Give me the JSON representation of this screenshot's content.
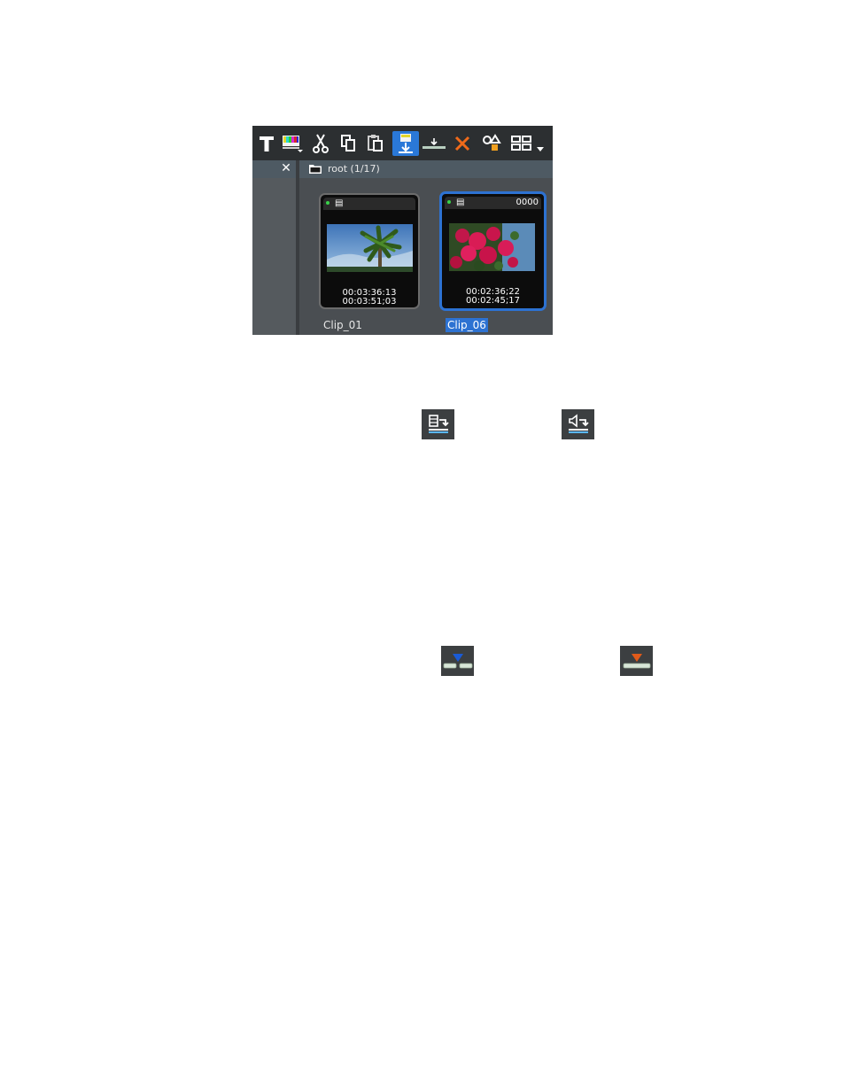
{
  "bin": {
    "folder_label": "root (1/17)",
    "close_glyph": "✕",
    "toolbar": [
      {
        "name": "title-icon",
        "active": false
      },
      {
        "name": "color-bars-icon",
        "active": false
      },
      {
        "name": "cut-icon",
        "active": false
      },
      {
        "name": "copy-icon",
        "active": false
      },
      {
        "name": "paste-icon",
        "active": false
      },
      {
        "name": "add-clip-to-timeline-icon",
        "active": true
      },
      {
        "name": "insert-to-timeline-icon",
        "active": false
      },
      {
        "name": "delete-icon",
        "active": false
      },
      {
        "name": "shapes-icon",
        "active": false
      },
      {
        "name": "view-mode-icon",
        "active": false
      }
    ],
    "clips": [
      {
        "name": "Clip_01",
        "count": "",
        "tc_in": "00:03:36:13",
        "tc_out": "00:03:51;03",
        "selected": false,
        "thumb": "palm-tree-sky"
      },
      {
        "name": "Clip_06",
        "count": "0000",
        "tc_in": "00:02:36;22",
        "tc_out": "00:02:45;17",
        "selected": true,
        "thumb": "pink-flowers"
      }
    ]
  },
  "icons": [
    {
      "name": "video-to-timeline-icon"
    },
    {
      "name": "audio-to-timeline-icon"
    },
    {
      "name": "insert-mode-icon",
      "accent": "#1a5bd6"
    },
    {
      "name": "overwrite-mode-icon",
      "accent": "#e05a1a"
    }
  ],
  "colors": {
    "selection_blue": "#2d72d2",
    "toolbar_bg": "#2c2f31",
    "insert_blue": "#1a5bd6",
    "overwrite_orange": "#e05a1a",
    "clip_dot_green": "#39d24a"
  }
}
